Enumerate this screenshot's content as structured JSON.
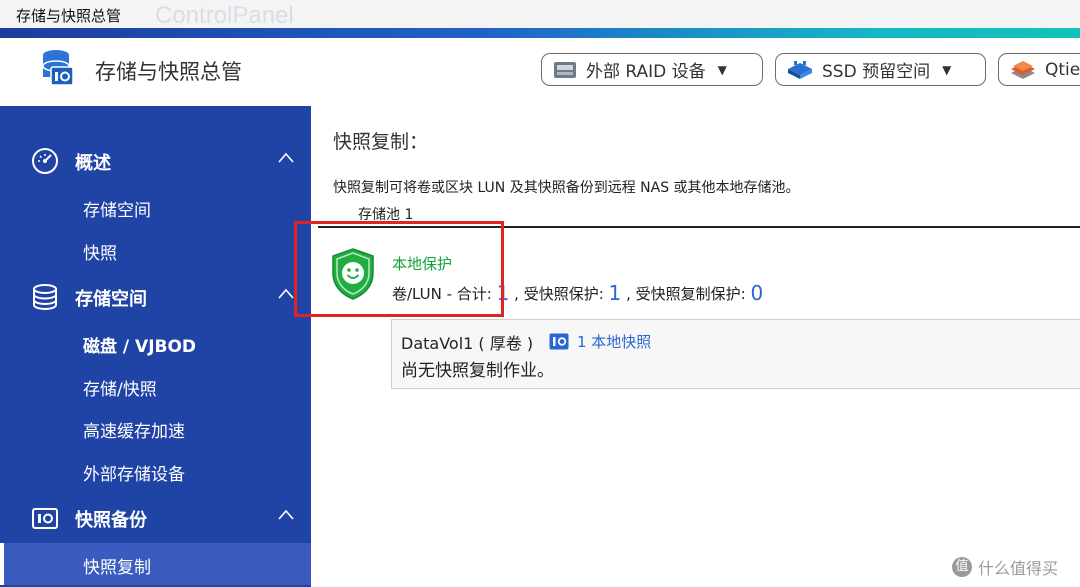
{
  "window": {
    "title": "存储与快照总管",
    "ghost_title": "ControlPanel"
  },
  "header": {
    "app_title": "存储与快照总管",
    "buttons": [
      {
        "label": "外部 RAID 设备",
        "icon": "raid-icon"
      },
      {
        "label": "SSD 预留空间",
        "icon": "ssd-icon"
      },
      {
        "label": "Qtie",
        "icon": "qtier-icon"
      }
    ]
  },
  "sidebar": {
    "groups": [
      {
        "label": "概述",
        "icon": "dashboard-icon",
        "items": [
          "存储空间",
          "快照"
        ]
      },
      {
        "label": "存储空间",
        "icon": "database-icon",
        "items": [
          "磁盘 / VJBOD",
          "存储/快照",
          "高速缓存加速",
          "外部存储设备"
        ]
      },
      {
        "label": "快照备份",
        "icon": "camera-icon",
        "items": [
          "快照复制"
        ]
      }
    ],
    "active_item": "快照复制"
  },
  "main": {
    "section_title": "快照复制：",
    "description": "快照复制可将卷或区块 LUN 及其快照备份到远程 NAS 或其他本地存储池。",
    "tab": "存储池 1",
    "protection": {
      "title": "本地保护",
      "line_prefix": "卷/LUN - 合计:",
      "total": "1",
      "snap_label": ", 受快照保护:",
      "snap_count": "1",
      "repl_label": ", 受快照复制保护:",
      "repl_count": "0"
    },
    "volume": {
      "name": "DataVol1 ( 厚卷 )",
      "snapshot_link": "1 本地快照",
      "status": "尚无快照复制作业。"
    }
  },
  "watermark": {
    "badge": "值",
    "text": "什么值得买"
  },
  "colors": {
    "sidebar": "#2043a6",
    "accent_link": "#2a66d4",
    "protect_green": "#12a43a",
    "highlight_red": "#e02424"
  }
}
